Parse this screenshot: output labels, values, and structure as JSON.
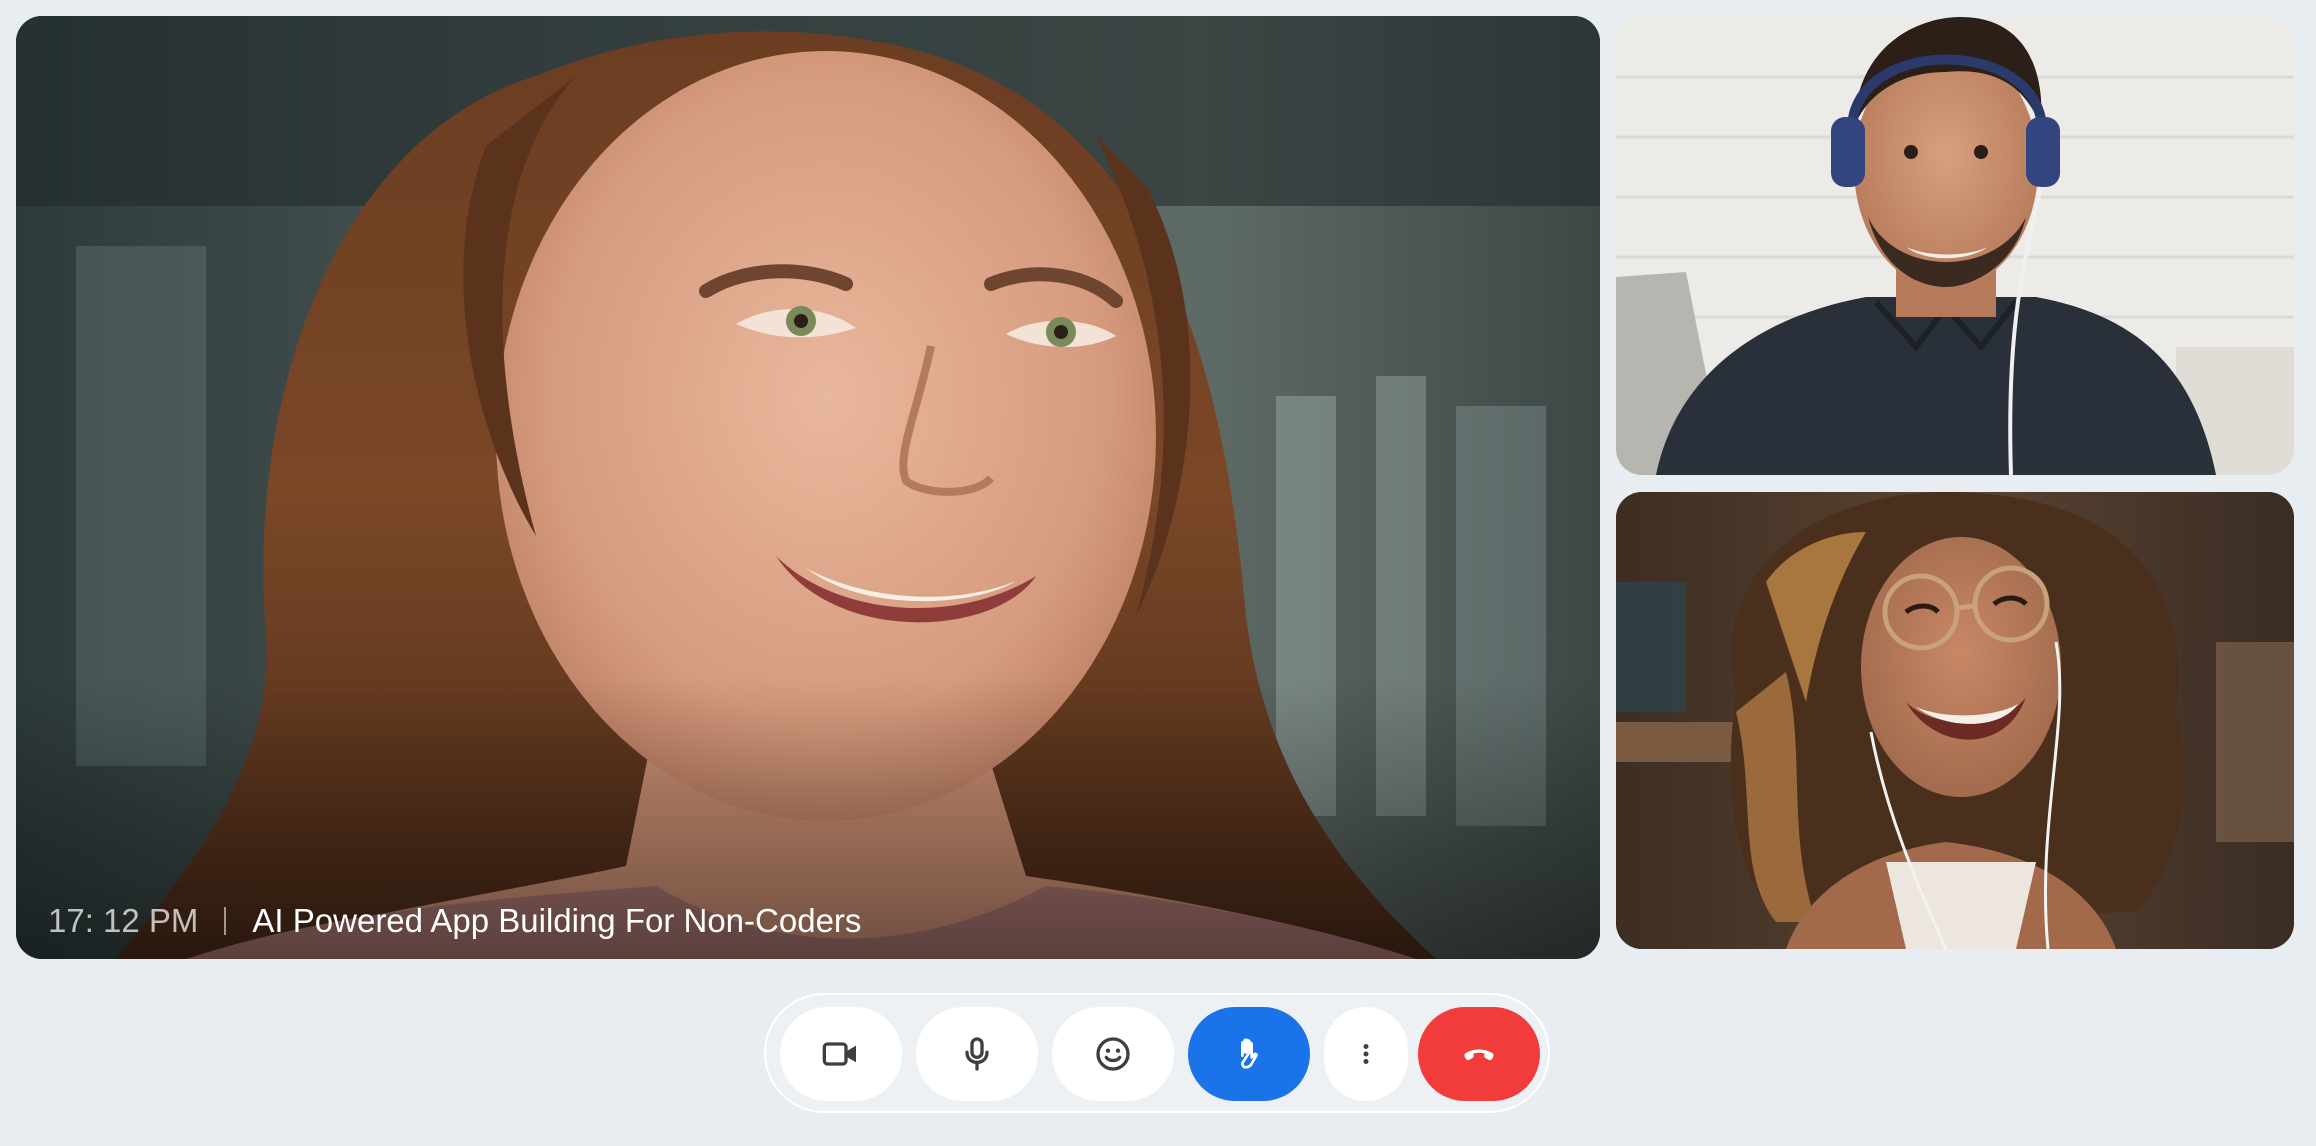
{
  "main_video": {
    "time": "17: 12 PM",
    "meeting_title": "AI Powered App Building For Non-Coders"
  },
  "controls": [
    {
      "name": "camera",
      "icon": "video-camera-icon"
    },
    {
      "name": "microphone",
      "icon": "microphone-icon"
    },
    {
      "name": "reactions",
      "icon": "smiley-icon"
    },
    {
      "name": "raise-hand",
      "icon": "hand-icon",
      "active": true
    },
    {
      "name": "more",
      "icon": "more-vertical-icon"
    },
    {
      "name": "end-call",
      "icon": "phone-hangup-icon"
    }
  ],
  "colors": {
    "background": "#e8edf1",
    "accent": "#1a73e8",
    "end_call": "#f23b3b",
    "icon": "#3c4043"
  }
}
